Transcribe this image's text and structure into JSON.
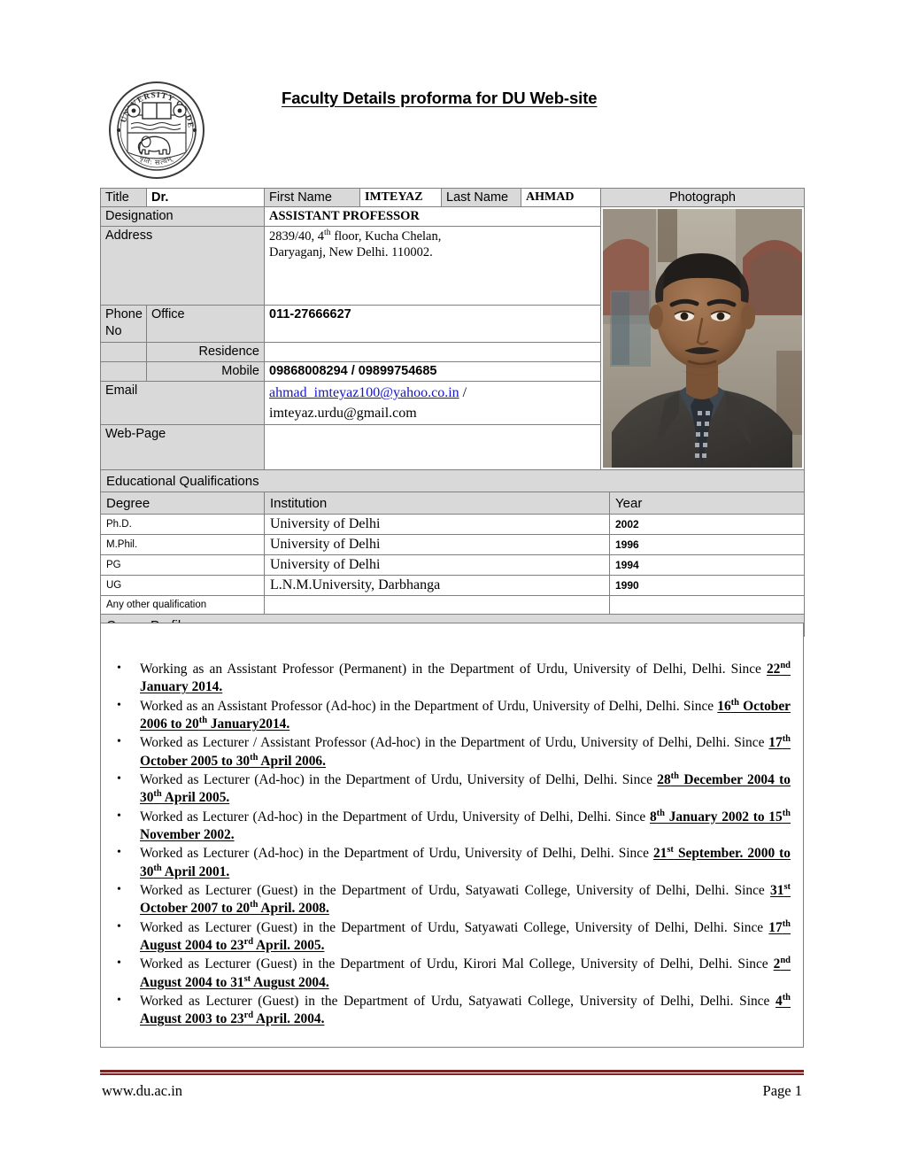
{
  "document": {
    "title": "Faculty Details proforma for DU Web-site",
    "logo_alt": "university-of-delhi-seal",
    "seal_text_top": "UNIVERSITY OF DELHI"
  },
  "info": {
    "title_label": "Title",
    "title_value": "Dr.",
    "first_name_label": "First Name",
    "first_name_value": "IMTEYAZ",
    "last_name_label": "Last Name",
    "last_name_value": "AHMAD",
    "photograph_label": "Photograph",
    "designation_label": "Designation",
    "designation_value": "ASSISTANT  PROFESSOR",
    "address_label": "Address",
    "address_line1": "2839/40, 4",
    "address_line1_sup": "th",
    "address_line1_rest": " floor, Kucha Chelan,",
    "address_line2": "Daryaganj, New Delhi. 110002.",
    "phone_label": "Phone No",
    "office_label": "Office",
    "office_value": "011-27666627",
    "residence_label": "Residence",
    "residence_value": "",
    "mobile_label": "Mobile",
    "mobile_value": "09868008294 / 09899754685",
    "email_label": "Email",
    "email_primary": "ahmad_imteyaz100@yahoo.co.in",
    "email_separator": " / ",
    "email_secondary": "imteyaz.urdu@gmail.com",
    "webpage_label": "Web-Page",
    "webpage_value": ""
  },
  "education": {
    "section_label": "Educational Qualifications",
    "columns": [
      "Degree",
      "Institution",
      "Year"
    ],
    "rows": [
      {
        "degree": "Ph.D.",
        "institution": "University of Delhi",
        "year": "2002"
      },
      {
        "degree": "M.Phil.",
        "institution": "University of Delhi",
        "year": "1996"
      },
      {
        "degree": "PG",
        "institution": "University of Delhi",
        "year": "1994"
      },
      {
        "degree": "UG",
        "institution": "L.N.M.University, Darbhanga",
        "year": "1990"
      }
    ],
    "other_label": "Any other qualification",
    "other_institution": "",
    "other_year": ""
  },
  "career": {
    "section_label": "Career Profile",
    "bullets": [
      "Working as an Assistant Professor (Permanent) in the Department of Urdu, University of Delhi, Delhi. Since <b>22<sup>nd</sup> January 2014.</b>",
      "Worked as an Assistant Professor (Ad-hoc) in the Department of Urdu, University of Delhi, Delhi. Since <b>16<sup>th</sup> October 2006 to 20<sup>th</sup> January2014.</b>",
      "Worked as Lecturer / Assistant Professor (Ad-hoc) in the Department of Urdu, University of Delhi, Delhi. Since <b>17<sup>th</sup> October 2005 to 30<sup>th</sup> April 2006.</b>",
      "Worked as Lecturer (Ad-hoc) in the Department of Urdu, University of Delhi, Delhi. Since <b>28<sup>th</sup> December 2004 to 30<sup>th</sup> April 2005.</b>",
      "Worked as Lecturer (Ad-hoc) in the Department of Urdu, University of Delhi, Delhi. Since <b>8<sup>th</sup> January 2002 to 15<sup>th</sup> November 2002.</b>",
      "Worked as Lecturer (Ad-hoc) in the Department of Urdu, University of Delhi, Delhi. Since <b>21<sup>st</sup> September. 2000 to 30<sup>th</sup> April 2001.</b>",
      "Worked as Lecturer (Guest) in the Department of Urdu, Satyawati College, University of Delhi, Delhi. Since <b>31<sup>st</sup> October 2007 to 20<sup>th</sup> April. 2008.</b>",
      "Worked as Lecturer (Guest) in the Department of Urdu, Satyawati College, University of Delhi, Delhi. Since <b>17<sup>th</sup> August 2004 to 23<sup>rd</sup> April. 2005.</b>",
      "Worked as Lecturer (Guest) in the Department of Urdu, Kirori Mal College, University of Delhi, Delhi. Since <b>2<sup>nd</sup> August 2004 to 31<sup>st</sup> August 2004.</b>",
      "Worked as Lecturer (Guest) in the Department of Urdu, Satyawati College, University of Delhi, Delhi. Since <b>4<sup>th</sup> August 2003 to 23<sup>rd</sup> April. 2004.</b>"
    ]
  },
  "footer": {
    "website": "www.du.ac.in",
    "page_number": "Page 1",
    "rule_color": "#7b2222"
  },
  "colors": {
    "label_shade": "#d9d9d9",
    "border": "#808080",
    "link": "#1414cc",
    "footer_rule": "#7b2222"
  }
}
